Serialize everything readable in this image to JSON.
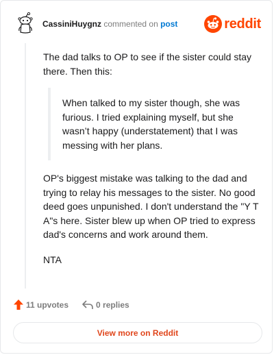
{
  "header": {
    "author": "CassiniHuygnz",
    "commented_text": "commented on",
    "post_link": "post",
    "brand_name": "reddit",
    "brand_color": "#ff4500"
  },
  "comment": {
    "intro": "The dad talks to OP to see if the sister could stay there. Then this:",
    "quote": "When talked to my sister though, she was furious. I tried explaining myself, but she wasn’t happy (understatement) that I was messing with her plans.",
    "paragraph": "OP's biggest mistake was talking to the dad and trying to relay his messages to the sister. No good deed goes unpunished. I don't understand the \"Y T A\"s here. Sister blew up when OP tried to express dad's concerns and work around them.",
    "verdict": "NTA"
  },
  "actions": {
    "upvotes_label": "11 upvotes",
    "replies_label": "0 replies",
    "upvote_icon": "upvote-arrow-icon",
    "reply_icon": "reply-arrow-icon"
  },
  "footer": {
    "view_more_label": "View more on Reddit"
  }
}
